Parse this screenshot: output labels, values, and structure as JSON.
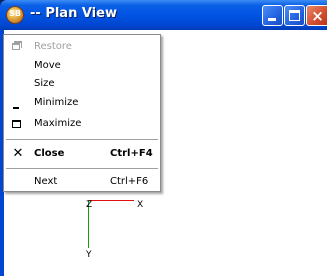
{
  "window": {
    "title": "-- Plan View",
    "app_icon": "app-logo-icon",
    "app_icon_text": "SB"
  },
  "viewport": {
    "axis_labels": {
      "x": "X",
      "y": "Y",
      "z": "Z"
    },
    "colors": {
      "x_axis": "#e01010",
      "y_axis": "#16a016"
    }
  },
  "system_menu": {
    "items": [
      {
        "label": "Restore",
        "icon": "restore-icon",
        "enabled": false
      },
      {
        "label": "Move",
        "enabled": true
      },
      {
        "label": "Size",
        "enabled": true
      },
      {
        "label": "Minimize",
        "icon": "minimize-icon",
        "enabled": true
      },
      {
        "label": "Maximize",
        "icon": "maximize-icon",
        "enabled": true
      },
      {
        "label": "Close",
        "shortcut": "Ctrl+F4",
        "icon": "close-icon",
        "enabled": true,
        "bold": true
      },
      {
        "label": "Next",
        "shortcut": "Ctrl+F6",
        "enabled": true
      }
    ]
  }
}
